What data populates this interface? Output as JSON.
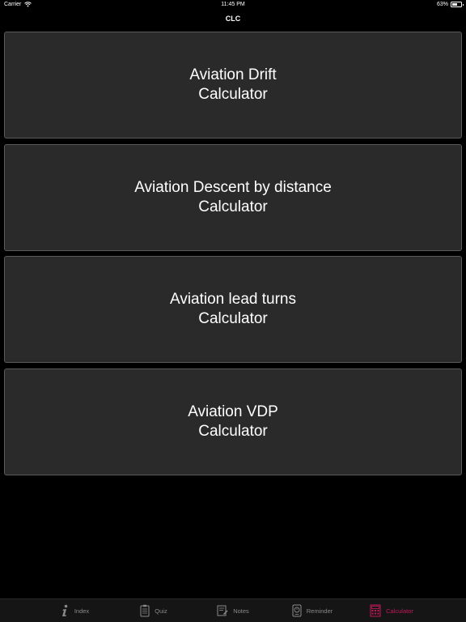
{
  "status_bar": {
    "carrier": "Carrier",
    "time": "11:45 PM",
    "battery": "63%",
    "battery_level": 0.63
  },
  "nav": {
    "title": "CLC"
  },
  "cards": [
    {
      "line1": "Aviation Drift",
      "line2": "Calculator"
    },
    {
      "line1": "Aviation Descent by distance",
      "line2": "Calculator"
    },
    {
      "line1": "Aviation lead turns",
      "line2": "Calculator"
    },
    {
      "line1": "Aviation VDP",
      "line2": "Calculator"
    }
  ],
  "tabs": [
    {
      "label": "Index",
      "icon": "info-icon"
    },
    {
      "label": "Quiz",
      "icon": "clipboard-icon"
    },
    {
      "label": "Notes",
      "icon": "notes-icon"
    },
    {
      "label": "Reminder",
      "icon": "reminder-icon"
    },
    {
      "label": "Calculator",
      "icon": "calculator-icon",
      "active": true
    }
  ],
  "colors": {
    "background": "#000000",
    "card": "#2a2a2a",
    "card_border": "#5a5a5a",
    "tab_inactive": "#8a8a8a",
    "tab_active": "#c2185b"
  }
}
